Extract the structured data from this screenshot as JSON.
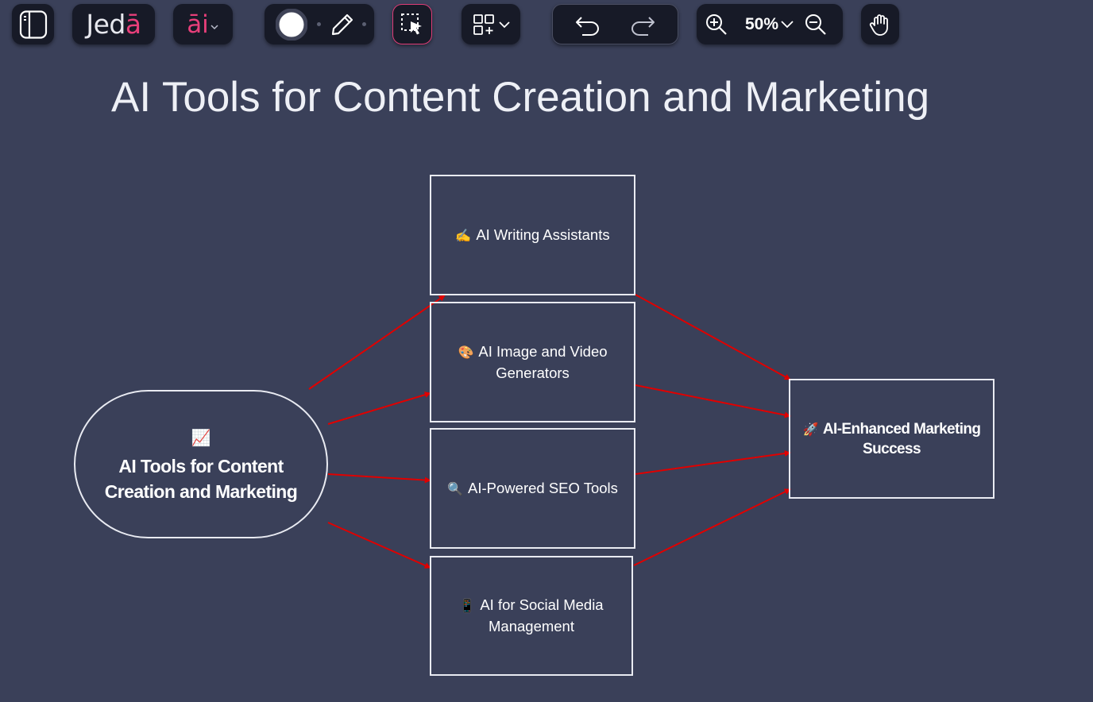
{
  "toolbar": {
    "logo": {
      "text_main": "Jed",
      "text_accent": "ā"
    },
    "ai_menu": {
      "label": "āi"
    },
    "zoom": {
      "level": "50%"
    },
    "colors": {
      "background": "#171a27",
      "accent": "#e83f7a"
    },
    "icons": [
      "sidebar-toggle-icon",
      "chevron-down-icon",
      "color-picker-icon",
      "pencil-icon",
      "select-cursor-icon",
      "add-shapes-icon",
      "undo-icon",
      "redo-icon",
      "zoom-in-icon",
      "zoom-out-icon",
      "hand-icon"
    ]
  },
  "canvas": {
    "title": "AI Tools for Content Creation and Marketing",
    "background": "#3a4059",
    "arrow_color": "#e00000",
    "nodes": {
      "center": {
        "emoji": "📈",
        "line1": "AI Tools for Content",
        "line2": "Creation and Marketing"
      },
      "writing": {
        "emoji": "✍️",
        "line1": "AI Writing Assistants"
      },
      "image": {
        "emoji": "🎨",
        "line1": "AI Image and Video",
        "line2": "Generators"
      },
      "seo": {
        "emoji": "🔍",
        "line1": "AI-Powered SEO Tools"
      },
      "social": {
        "emoji": "📱",
        "line1": "AI for Social Media",
        "line2": "Management"
      },
      "result": {
        "emoji": "🚀",
        "line1": "AI-Enhanced Marketing",
        "line2": "Success"
      }
    }
  }
}
